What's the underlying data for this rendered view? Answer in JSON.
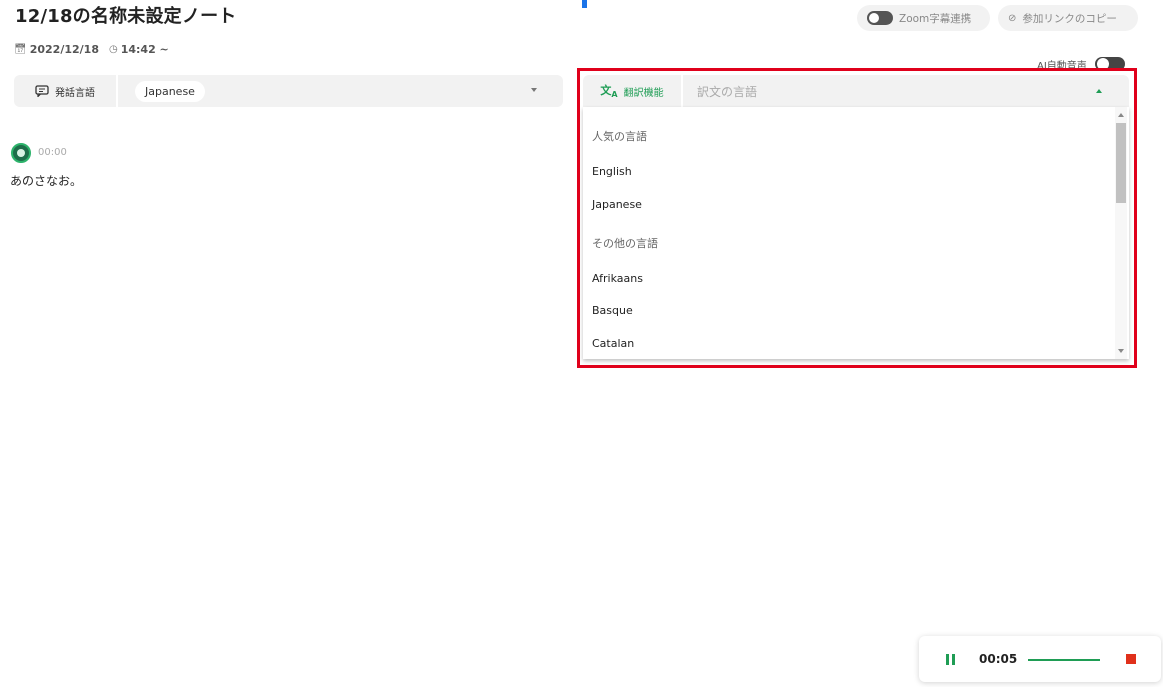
{
  "note": {
    "title": "12/18の名称未設定ノート",
    "date": "2022/12/18",
    "time": "14:42 ~"
  },
  "header": {
    "zoom_caption_label": "Zoom字幕連携",
    "copy_link_label": "参加リンクのコピー",
    "ai_auto_voice_label": "AI自動音声"
  },
  "speech": {
    "label": "発話言語",
    "value": "Japanese"
  },
  "translation": {
    "label": "翻訳機能",
    "placeholder": "訳文の言語",
    "options": [
      {
        "text": "人気の言語",
        "kind": "header"
      },
      {
        "text": "English",
        "kind": "option"
      },
      {
        "text": "Japanese",
        "kind": "option"
      },
      {
        "text": "その他の言語",
        "kind": "header"
      },
      {
        "text": "Afrikaans",
        "kind": "option"
      },
      {
        "text": "Basque",
        "kind": "option"
      },
      {
        "text": "Catalan",
        "kind": "option"
      }
    ]
  },
  "transcript": [
    {
      "time": "00:00",
      "text": "あのさなお。"
    }
  ],
  "player": {
    "elapsed": "00:05"
  },
  "colors": {
    "accent_green": "#1f9d55",
    "highlight_red": "#e0001b",
    "stop_red": "#e0301b"
  },
  "icons": {
    "calendar": "calendar-icon",
    "clock": "clock-icon",
    "link": "link-icon",
    "speech": "speech-bubble-icon",
    "translate": "translate-icon"
  }
}
